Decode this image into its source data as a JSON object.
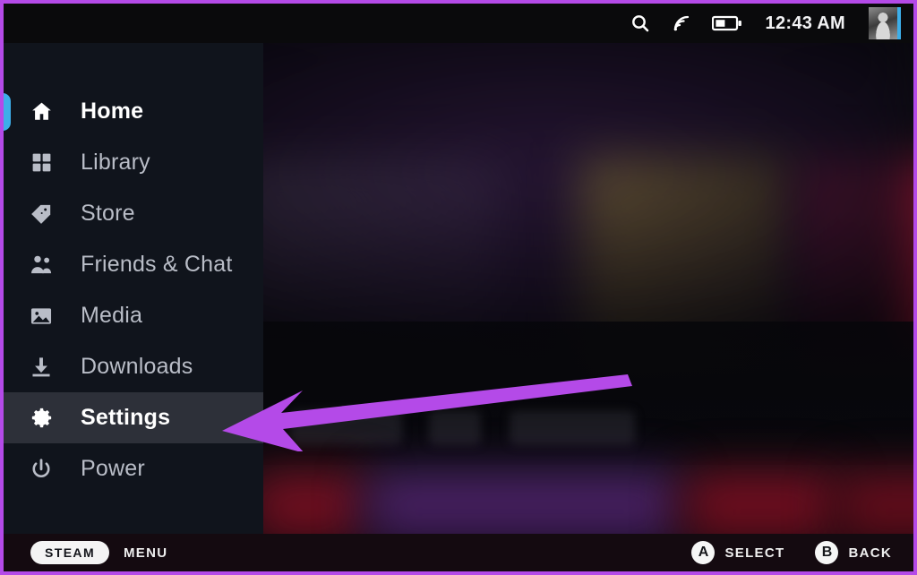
{
  "window": {
    "title": "Steam Deck Gaming Mode",
    "annotation_arrow_color": "#b44ae8",
    "border_color": "#b44ae8"
  },
  "topbar": {
    "icons": [
      {
        "name": "search-icon",
        "label": "Search"
      },
      {
        "name": "wifi-icon",
        "label": "Wi-Fi"
      },
      {
        "name": "battery-icon",
        "label": "Battery"
      }
    ],
    "clock": "12:43 AM",
    "avatar": {
      "name": "user-avatar",
      "status": "online",
      "status_color": "#3daee9"
    }
  },
  "sidebar": {
    "accent_color": "#3daee9",
    "highlight_color": "#2d3039",
    "items": [
      {
        "label": "Home",
        "icon": "home-icon",
        "state": "selected"
      },
      {
        "label": "Library",
        "icon": "library-icon",
        "state": "normal"
      },
      {
        "label": "Store",
        "icon": "tag-icon",
        "state": "normal"
      },
      {
        "label": "Friends & Chat",
        "icon": "friends-icon",
        "state": "normal"
      },
      {
        "label": "Media",
        "icon": "media-icon",
        "state": "normal"
      },
      {
        "label": "Downloads",
        "icon": "download-icon",
        "state": "normal"
      },
      {
        "label": "Settings",
        "icon": "gear-icon",
        "state": "focused"
      },
      {
        "label": "Power",
        "icon": "power-icon",
        "state": "normal"
      }
    ]
  },
  "bottombar": {
    "steam_pill": "STEAM",
    "menu_label": "MENU",
    "hints": [
      {
        "glyph": "A",
        "label": "SELECT"
      },
      {
        "glyph": "B",
        "label": "BACK"
      }
    ]
  }
}
